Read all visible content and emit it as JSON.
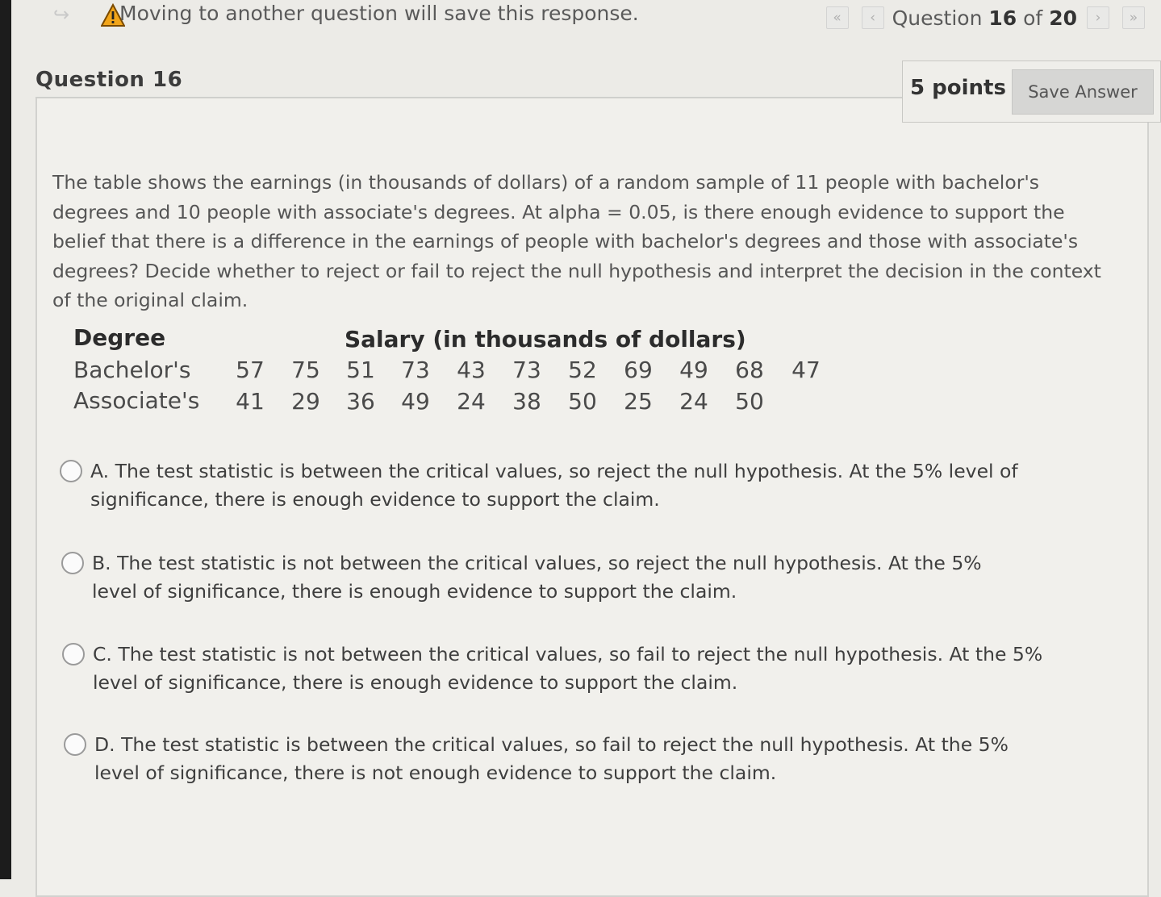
{
  "warning": {
    "text": "Moving to another question will save this response."
  },
  "nav": {
    "first_label": "«",
    "prev_label": "‹",
    "next_label": "›",
    "last_label": "»",
    "question_word": "Question",
    "current": "16",
    "of_word": "of",
    "total": "20"
  },
  "question": {
    "title": "Question 16",
    "points": "5 points",
    "save_label": "Save Answer",
    "prompt": "The table shows the earnings (in thousands of dollars) of a random sample of 11 people with bachelor's degrees and 10 people with associate's degrees. At alpha = 0.05, is there enough evidence to support the belief that there is a difference in the earnings of people with bachelor's degrees and those with associate's degrees? Decide whether to reject or fail to reject the null hypothesis and interpret the decision in the context of the original claim."
  },
  "table": {
    "header_degree": "Degree",
    "header_salary": "Salary (in thousands of dollars)",
    "rows": [
      {
        "label": "Bachelor's",
        "values": [
          "57",
          "75",
          "51",
          "73",
          "43",
          "73",
          "52",
          "69",
          "49",
          "68",
          "47"
        ]
      },
      {
        "label": "Associate's",
        "values": [
          "41",
          "29",
          "36",
          "49",
          "24",
          "38",
          "50",
          "25",
          "24",
          "50"
        ]
      }
    ]
  },
  "options": [
    {
      "letter": "A.",
      "text": "The test statistic is between the critical values, so reject the null hypothesis. At the 5% level of significance, there is enough evidence to support the claim."
    },
    {
      "letter": "B.",
      "text": "The test statistic is not between the critical values, so reject the null hypothesis. At the 5% level of significance, there is enough evidence to support the claim."
    },
    {
      "letter": "C.",
      "text": "The test statistic is not between the critical values, so fail to reject the null hypothesis. At the 5% level of significance, there is enough evidence to support the claim."
    },
    {
      "letter": "D.",
      "text": "The test statistic is between the critical values, so fail to reject the null hypothesis. At the 5% level of significance, there is not enough evidence to support the claim."
    }
  ],
  "colors": {
    "warning_fill": "#f2a51a",
    "background": "#ecebe7"
  },
  "icons": {
    "warning": "warning-triangle-icon",
    "back": "return-arrow-icon"
  }
}
